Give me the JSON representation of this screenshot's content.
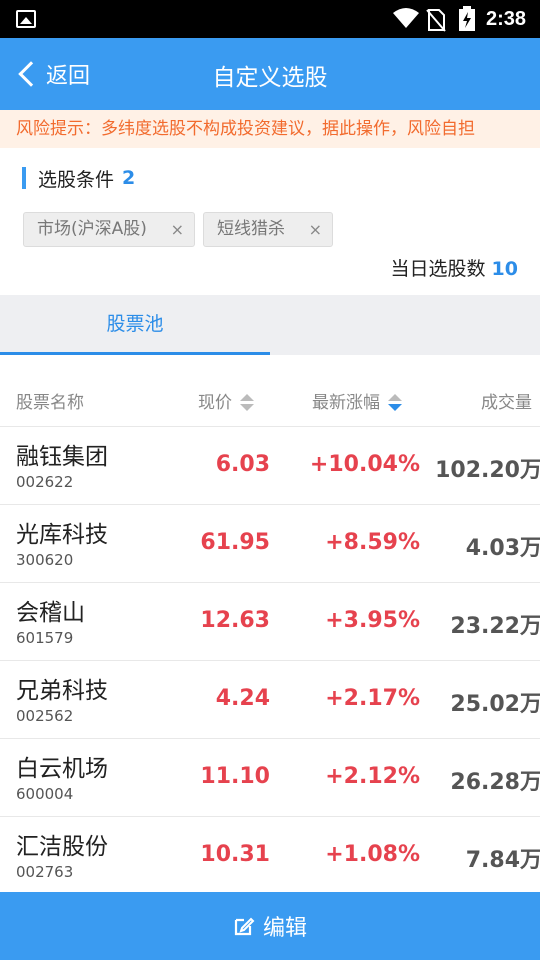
{
  "status_bar": {
    "time": "2:38"
  },
  "header": {
    "back_label": "返回",
    "title": "自定义选股"
  },
  "risk_notice": "风险提示：多纬度选股不构成投资建议，据此操作，风险自担",
  "conditions": {
    "title": "选股条件",
    "count": "2",
    "tags": [
      {
        "label": "市场(沪深A股)",
        "close": "×"
      },
      {
        "label": "短线猎杀",
        "close": "×"
      }
    ],
    "day_count_label": "当日选股数",
    "day_count": "10"
  },
  "tabs": [
    {
      "label": "股票池",
      "active": true
    }
  ],
  "table": {
    "headers": {
      "name": "股票名称",
      "price": "现价",
      "change": "最新涨幅",
      "volume": "成交量"
    },
    "rows": [
      {
        "name": "融钰集团",
        "code": "002622",
        "price": "6.03",
        "change": "+10.04%",
        "volume": "102.20万"
      },
      {
        "name": "光库科技",
        "code": "300620",
        "price": "61.95",
        "change": "+8.59%",
        "volume": "4.03万"
      },
      {
        "name": "会稽山",
        "code": "601579",
        "price": "12.63",
        "change": "+3.95%",
        "volume": "23.22万"
      },
      {
        "name": "兄弟科技",
        "code": "002562",
        "price": "4.24",
        "change": "+2.17%",
        "volume": "25.02万"
      },
      {
        "name": "白云机场",
        "code": "600004",
        "price": "11.10",
        "change": "+2.12%",
        "volume": "26.28万"
      },
      {
        "name": "汇洁股份",
        "code": "002763",
        "price": "10.31",
        "change": "+1.08%",
        "volume": "7.84万"
      }
    ]
  },
  "bottom_button": {
    "label": "编辑"
  },
  "colors": {
    "primary": "#3a9bf1",
    "up_red": "#e6424e",
    "warning_orange": "#f26b2e"
  }
}
